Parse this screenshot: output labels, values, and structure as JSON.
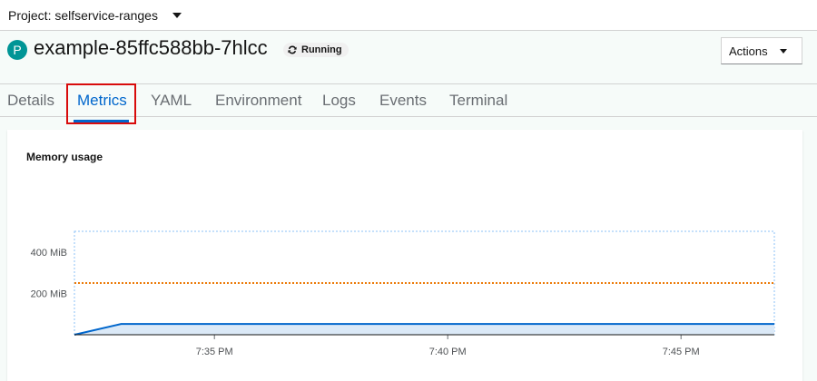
{
  "project": {
    "label": "Project: selfservice-ranges"
  },
  "pod": {
    "badge": "P",
    "name": "example-85ffc588bb-7hlcc",
    "status": "Running"
  },
  "actions": {
    "label": "Actions"
  },
  "tabs": [
    {
      "label": "Details"
    },
    {
      "label": "Metrics"
    },
    {
      "label": "YAML"
    },
    {
      "label": "Environment"
    },
    {
      "label": "Logs"
    },
    {
      "label": "Events"
    },
    {
      "label": "Terminal"
    }
  ],
  "active_tab": "Metrics",
  "card": {
    "title": "Memory usage"
  },
  "colors": {
    "accent": "#0066cc",
    "limit_line": "#ec7a08",
    "usage_fill": "#dbe9f7",
    "highlight": "#d80b0b",
    "pod_badge": "#009596"
  },
  "chart_data": {
    "type": "area",
    "title": "Memory usage",
    "y_unit": "MiB",
    "ylim": [
      0,
      500
    ],
    "y_ticks": [
      {
        "value": 200,
        "label": "200 MiB"
      },
      {
        "value": 400,
        "label": "400 MiB"
      }
    ],
    "x_ticks": [
      "7:35 PM",
      "7:40 PM",
      "7:45 PM"
    ],
    "series": [
      {
        "values": [
          {
            "x": "7:32 PM",
            "y": 0
          },
          {
            "x": "7:33 PM",
            "y": 52
          },
          {
            "x": "7:47 PM",
            "y": 52
          }
        ]
      }
    ],
    "limit_line": {
      "y": 250
    }
  }
}
